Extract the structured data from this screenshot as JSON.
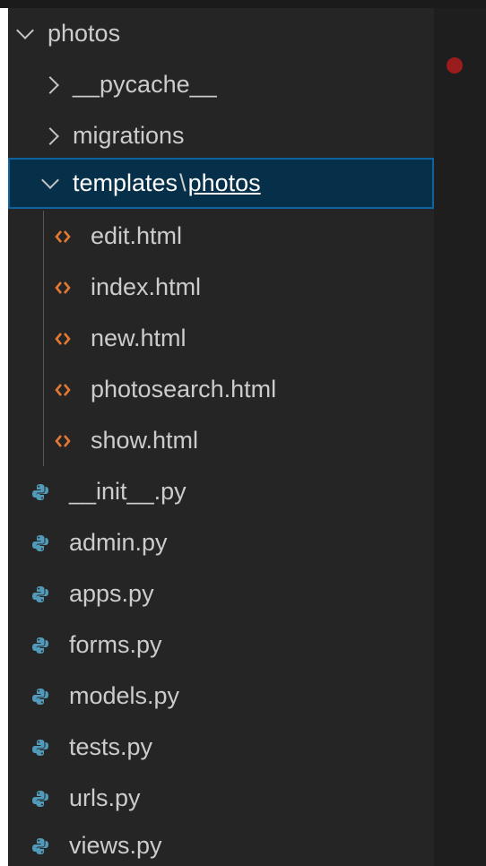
{
  "explorer": {
    "root_folder": "photos",
    "folders": [
      {
        "label": "__pycache__"
      },
      {
        "label": "migrations"
      }
    ],
    "selected_folder": {
      "label": "templates",
      "separator": "\\",
      "sub": "photos"
    },
    "template_files": [
      {
        "label": "edit.html"
      },
      {
        "label": "index.html"
      },
      {
        "label": "new.html"
      },
      {
        "label": "photosearch.html"
      },
      {
        "label": "show.html"
      }
    ],
    "py_files": [
      {
        "label": "__init__.py"
      },
      {
        "label": "admin.py"
      },
      {
        "label": "apps.py"
      },
      {
        "label": "forms.py"
      },
      {
        "label": "models.py"
      },
      {
        "label": "tests.py"
      },
      {
        "label": "urls.py"
      },
      {
        "label": "views.py"
      }
    ]
  },
  "colors": {
    "background": "#252526",
    "selection": "#062f4a",
    "selection_border": "#0e639c",
    "html_icon": "#e37933",
    "python_icon": "#519aba",
    "breakpoint_dot": "#9b1c1c"
  },
  "icons": {
    "folder_expanded": "chevron-down-icon",
    "folder_collapsed": "chevron-right-icon",
    "html_file": "html-file-icon",
    "python_file": "python-file-icon"
  }
}
